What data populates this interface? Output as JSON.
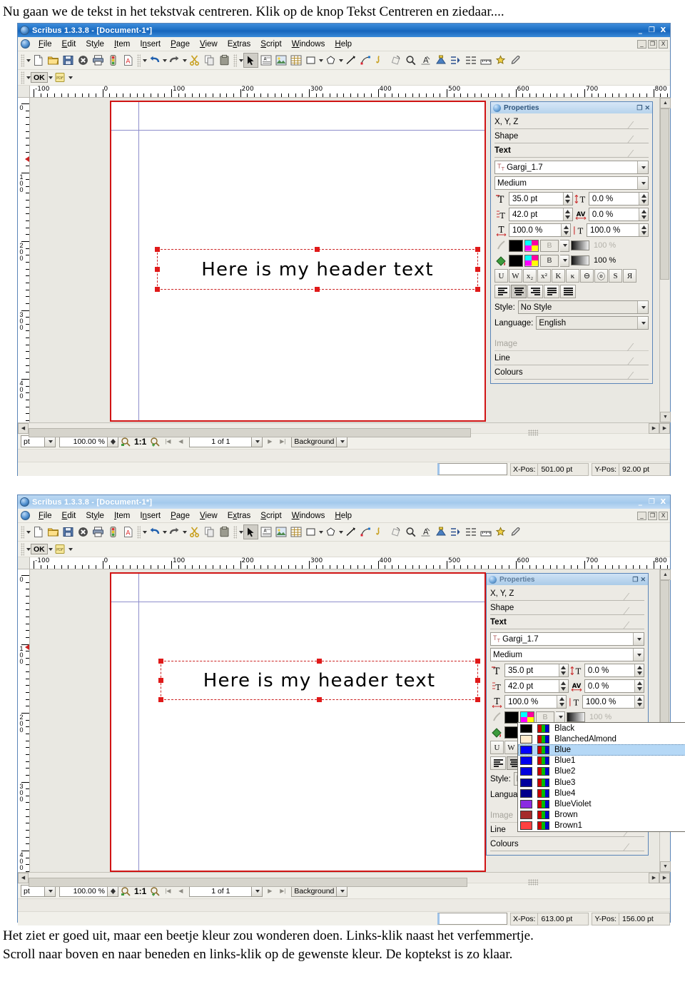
{
  "caption_top": "Nu gaan we de tekst in het tekstvak centreren. Klik op de knop Tekst Centreren en ziedaar....",
  "caption_bottom_line1": "Het ziet er goed uit, maar een beetje kleur zou wonderen doen. Links-klik naast het verfemmertje.",
  "caption_bottom_line2": "Scroll naar boven en naar beneden en links-klik op de gewenste kleur. De koptekst is zo klaar.",
  "window": {
    "title": "Scribus 1.3.3.8 - [Document-1*]",
    "titlebar_buttons": [
      "_",
      "❐",
      "X"
    ],
    "menus": [
      "File",
      "Edit",
      "Style",
      "Item",
      "Insert",
      "Page",
      "View",
      "Extras",
      "Script",
      "Windows",
      "Help"
    ],
    "mdi_buttons": [
      "_",
      "❐",
      "X"
    ],
    "toolbar_main_icons": [
      "new-document-icon",
      "open-folder-icon",
      "save-icon",
      "close-icon",
      "print-icon",
      "preflight-icon",
      "export-pdf-icon",
      "undo-icon",
      "redo-icon",
      "cut-icon",
      "copy-icon",
      "paste-icon"
    ],
    "toolbar_tools_icons": [
      "select-pointer-icon",
      "text-frame-icon",
      "image-frame-icon",
      "table-icon",
      "shape-icon",
      "polygon-icon",
      "line-icon",
      "bezier-icon",
      "freehand-icon",
      "rotate-icon",
      "zoom-icon",
      "edit-contents-icon",
      "link-text-frames-icon",
      "unlink-text-frames-icon",
      "measurements-icon",
      "copy-properties-icon",
      "eye-dropper-icon"
    ],
    "toolbar_pdf": {
      "ok_label": "OK",
      "pdf_label": "PDF"
    }
  },
  "ruler": {
    "unit": "pt",
    "horizontal_labels": [
      "-100",
      "0",
      "100",
      "200",
      "300",
      "400",
      "500",
      "600",
      "700",
      "800"
    ],
    "vertical_labels": [
      "0",
      "100",
      "200",
      "300",
      "400"
    ]
  },
  "canvas": {
    "frame_text": "Here is my header text",
    "page_border_color": "#d01414",
    "margin_guide_color": "#8e8ecb",
    "handle_color": "#e01a1a"
  },
  "properties": {
    "title": "Properties",
    "title_buttons": [
      "❐",
      "✕"
    ],
    "sections": [
      {
        "label": "X, Y, Z",
        "state": "normal"
      },
      {
        "label": "Shape",
        "state": "normal"
      },
      {
        "label": "Text",
        "state": "bold"
      }
    ],
    "bottom_sections": [
      {
        "label": "Image",
        "state": "dim"
      },
      {
        "label": "Line",
        "state": "normal"
      },
      {
        "label": "Colours",
        "state": "normal"
      }
    ],
    "font_family": "Gargi_1.7",
    "font_style": "Medium",
    "font_size": "35.0 pt",
    "line_spacing": "42.0 pt",
    "baseline_offset": "0.0 %",
    "tracking": "0.0 %",
    "scale_h": "100.0 %",
    "scale_v": "100.0 %",
    "stroke_shade_pct": "100 %",
    "fill_shade_pct": "100 %",
    "color_mode_label": "B",
    "format_buttons": [
      "U",
      "W",
      "x₂",
      "x²",
      "K",
      "κ",
      "⊖",
      "ⓞ",
      "S",
      "Я"
    ],
    "align_buttons": [
      "align-left",
      "align-center",
      "align-right",
      "align-block",
      "align-forced"
    ],
    "align_selected_index": 1,
    "style_label": "Style:",
    "style_value": "No Style",
    "language_label": "Language:",
    "language_value": "English"
  },
  "colour_dropdown": {
    "items": [
      {
        "name": "Black",
        "hex": "#000000"
      },
      {
        "name": "BlanchedAlmond",
        "hex": "#ffebcd"
      },
      {
        "name": "Blue",
        "hex": "#0000ff"
      },
      {
        "name": "Blue1",
        "hex": "#0000ee"
      },
      {
        "name": "Blue2",
        "hex": "#0000dd"
      },
      {
        "name": "Blue3",
        "hex": "#00009e"
      },
      {
        "name": "Blue4",
        "hex": "#00008b"
      },
      {
        "name": "BlueViolet",
        "hex": "#8a2be2"
      },
      {
        "name": "Brown",
        "hex": "#a52a2a"
      },
      {
        "name": "Brown1",
        "hex": "#ff4040"
      }
    ],
    "selected": "Blue",
    "selected_index": 2
  },
  "statusbar": {
    "unit": "pt",
    "zoom": "100.00 %",
    "ratio": "1:1",
    "page_indicator": "1 of 1",
    "layer": "Background",
    "nav_buttons": [
      "first-page",
      "previous-page",
      "next-page",
      "last-page"
    ],
    "zoom_out_icon": "zoom-out-icon",
    "zoom_in_icon": "zoom-in-icon"
  },
  "position_top": {
    "x_label": "X-Pos:",
    "x_value": "501.00 pt",
    "y_label": "Y-Pos:",
    "y_value": "92.00 pt"
  },
  "position_bottom": {
    "x_label": "X-Pos:",
    "x_value": "613.00 pt",
    "y_label": "Y-Pos:",
    "y_value": "156.00 pt"
  }
}
